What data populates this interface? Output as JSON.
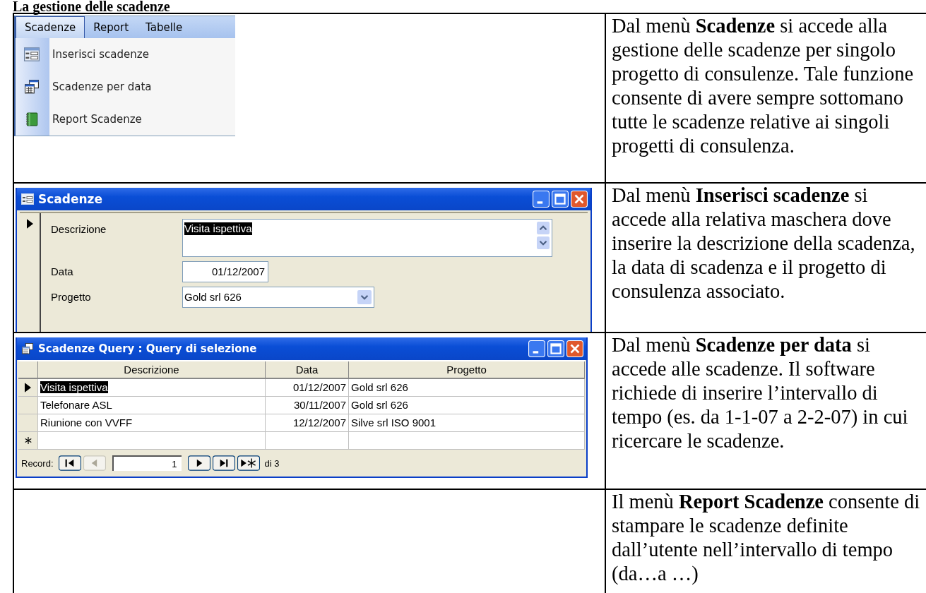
{
  "heading": "La gestione delle scadenze",
  "sections": [
    {
      "kind": "menu",
      "menu": {
        "tabs": [
          {
            "label": "Scadenze",
            "selected": true
          },
          {
            "label": "Report",
            "selected": false
          },
          {
            "label": "Tabelle",
            "selected": false
          }
        ],
        "items": [
          {
            "label": "Inserisci scadenze",
            "kind": "form"
          },
          {
            "label": "Scadenze per data",
            "kind": "query"
          },
          {
            "label": "Report Scadenze",
            "kind": "report"
          }
        ]
      },
      "text": "Dal menù **Scadenze** si accede alla gestione delle scadenze per singolo progetto di consulenze. Tale funzione consente di avere sempre sottomano tutte le scadenze relative ai singoli progetti di consulenza."
    },
    {
      "kind": "form",
      "window": {
        "title": "Scadenze",
        "fields": [
          {
            "label": "Descrizione",
            "value": "Visita ispettiva",
            "kind": "memo",
            "highlighted": true
          },
          {
            "label": "Data",
            "value": "01/12/2007",
            "kind": "date",
            "highlighted": false
          },
          {
            "label": "Progetto",
            "value": "Gold srl 626",
            "kind": "combo",
            "highlighted": false
          }
        ]
      },
      "text": "Dal menù **Inserisci scadenze** si accede alla relativa maschera dove inserire la descrizione della scadenza, la data di scadenza e il progetto di consulenza associato."
    },
    {
      "kind": "datasheet",
      "window": {
        "title": "Scadenze Query : Query di selezione",
        "columns": [
          "Descrizione",
          "Data",
          "Progetto"
        ],
        "rows": [
          {
            "cells": [
              "Visita ispettiva",
              "01/12/2007",
              "Gold srl 626"
            ],
            "selected": true
          },
          {
            "cells": [
              "Telefonare ASL",
              "30/11/2007",
              "Gold srl 626"
            ],
            "selected": false
          },
          {
            "cells": [
              "Riunione con VVFF",
              "12/12/2007",
              "Silve srl ISO 9001"
            ],
            "selected": false
          }
        ],
        "navigator": {
          "label": "Record:",
          "current": "1",
          "total": "di 3"
        }
      },
      "text": "Dal menù **Scadenze per data** si accede alle scadenze. Il software richiede di inserire l’intervallo di tempo (es. da 1-1-07 a  2-2-07) in cui ricercare le scadenze."
    },
    {
      "kind": "empty",
      "text": "Il menù **Report Scadenze** consente di stampare le scadenze definite dall’utente nell’intervallo di tempo (da…a …)"
    }
  ]
}
